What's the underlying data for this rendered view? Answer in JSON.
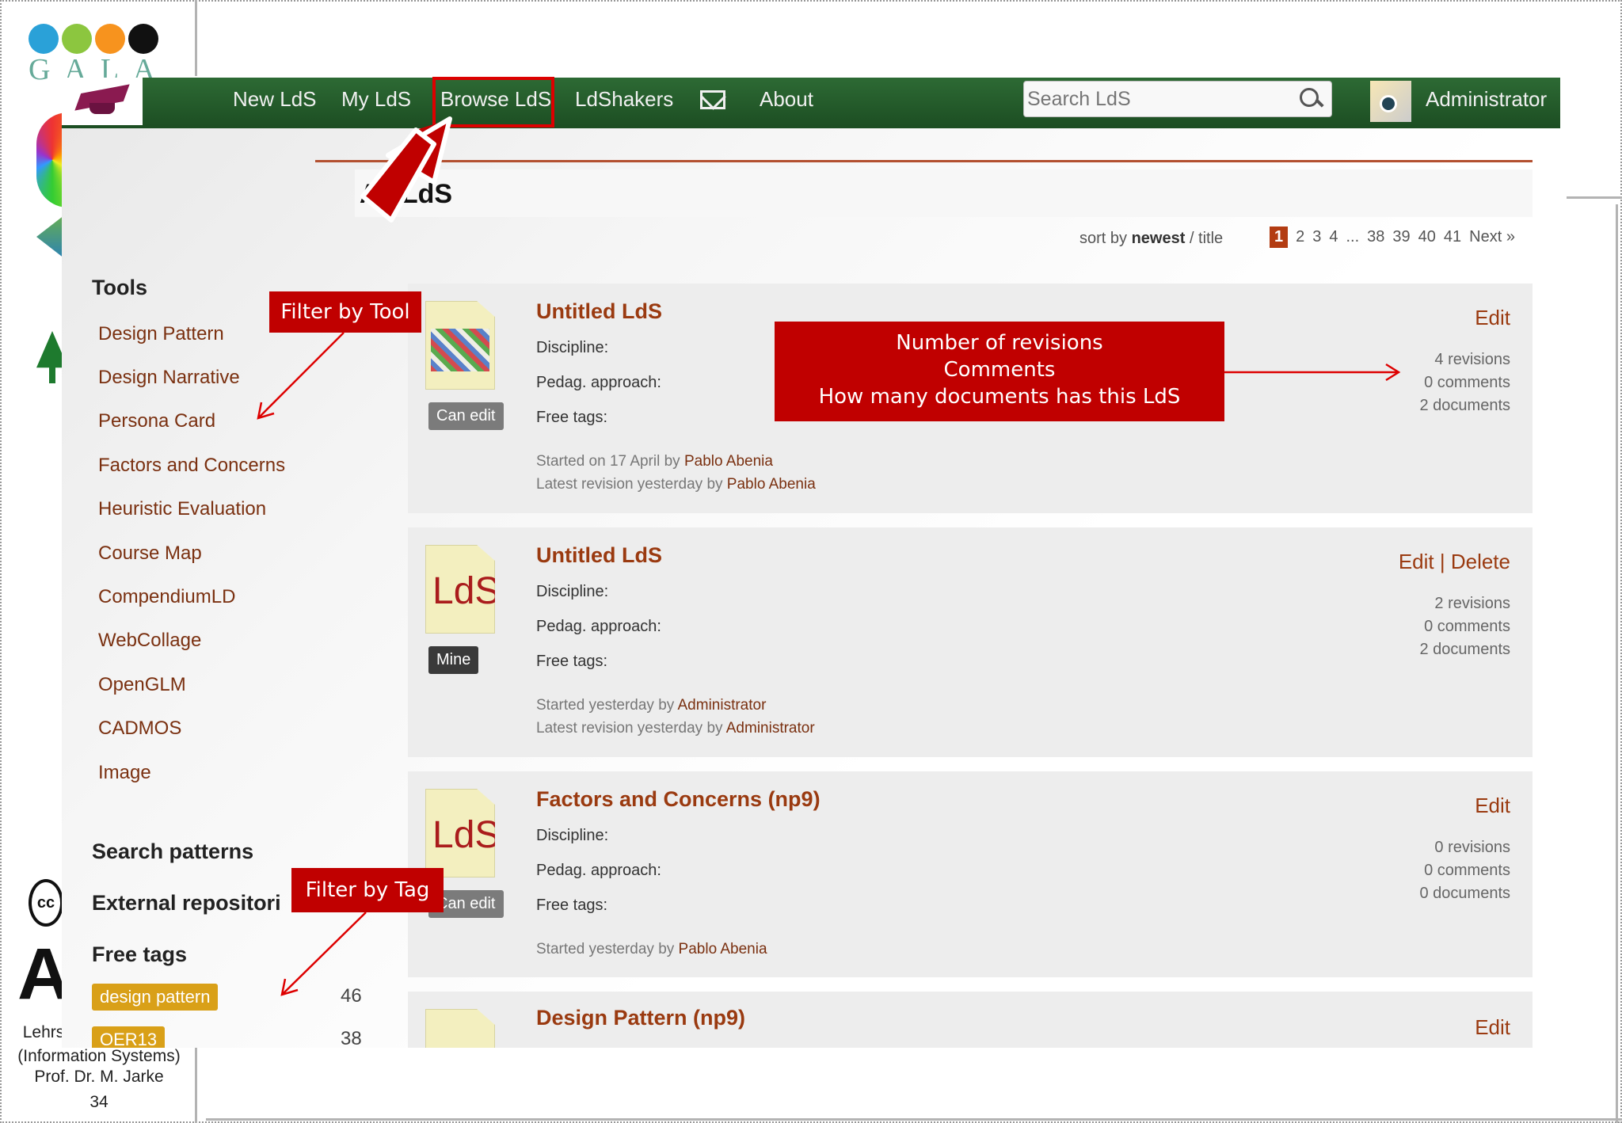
{
  "slide": {
    "footer_line1": "Lehrs",
    "footer_line2": "(Information Systems)",
    "footer_line3": "Prof. Dr. M. Jarke",
    "slide_number": "34",
    "gala_text": "GALA",
    "cc_text": "cc",
    "big_letter": "A"
  },
  "nav": {
    "items": [
      "New LdS",
      "My LdS",
      "Browse LdS",
      "LdShakers",
      "About"
    ],
    "search_placeholder": "Search LdS",
    "user": "Administrator",
    "icons": [
      "mail-icon",
      "search-icon",
      "avatar"
    ]
  },
  "page": {
    "title": "All LdS",
    "sort_prefix": "sort by ",
    "sort_active": "newest",
    "sort_alt": " / title",
    "pager": [
      "1",
      "2",
      "3",
      "4",
      "...",
      "38",
      "39",
      "40",
      "41",
      "Next »"
    ]
  },
  "sidebar": {
    "tools_heading": "Tools",
    "tools": [
      "Design Pattern",
      "Design Narrative",
      "Persona Card",
      "Factors and Concerns",
      "Heuristic Evaluation",
      "Course Map",
      "CompendiumLD",
      "WebCollage",
      "OpenGLM",
      "CADMOS",
      "Image"
    ],
    "search_patterns": "Search patterns",
    "external_repos": "External repositori",
    "free_tags_heading": "Free tags",
    "tags": [
      {
        "label": "design pattern",
        "count": "46"
      },
      {
        "label": "OER13",
        "count": "38"
      }
    ]
  },
  "cards": [
    {
      "title": "Untitled LdS",
      "discipline": "Discipline:",
      "pedag": "Pedag. approach:",
      "tags": "Free tags:",
      "badge": "Can edit",
      "thumb": "collage",
      "started_prefix": "Started on 17 April by ",
      "started_by": "Pablo Abenia",
      "latest_prefix": "Latest revision yesterday by ",
      "latest_by": "Pablo Abenia",
      "actions": "Edit",
      "revisions": "4 revisions",
      "comments": "0 comments",
      "documents": "2 documents"
    },
    {
      "title": "Untitled LdS",
      "discipline": "Discipline:",
      "pedag": "Pedag. approach:",
      "tags": "Free tags:",
      "badge": "Mine",
      "thumb": "LdS",
      "started_prefix": "Started yesterday by ",
      "started_by": "Administrator",
      "latest_prefix": "Latest revision yesterday by ",
      "latest_by": "Administrator",
      "actions": "Edit | Delete",
      "revisions": "2 revisions",
      "comments": "0 comments",
      "documents": "2 documents"
    },
    {
      "title": "Factors and Concerns (np9)",
      "discipline": "Discipline:",
      "pedag": "Pedag. approach:",
      "tags": "Free tags:",
      "badge": "Can edit",
      "thumb": "LdS",
      "started_prefix": "Started yesterday by ",
      "started_by": "Pablo Abenia",
      "actions": "Edit",
      "revisions": "0 revisions",
      "comments": "0 comments",
      "documents": "0 documents"
    },
    {
      "title": "Design Pattern (np9)",
      "actions": "Edit"
    }
  ],
  "callouts": {
    "filter_tool": "Filter by Tool",
    "filter_tag": "Filter by Tag",
    "info_line1": "Number of revisions",
    "info_line2": "Comments",
    "info_line3": "How many documents has this LdS"
  },
  "colors": {
    "nav_green": "#1f5226",
    "callout_red": "#c00000",
    "link_brown": "#9a3a10",
    "tag_gold": "#d9a018"
  }
}
